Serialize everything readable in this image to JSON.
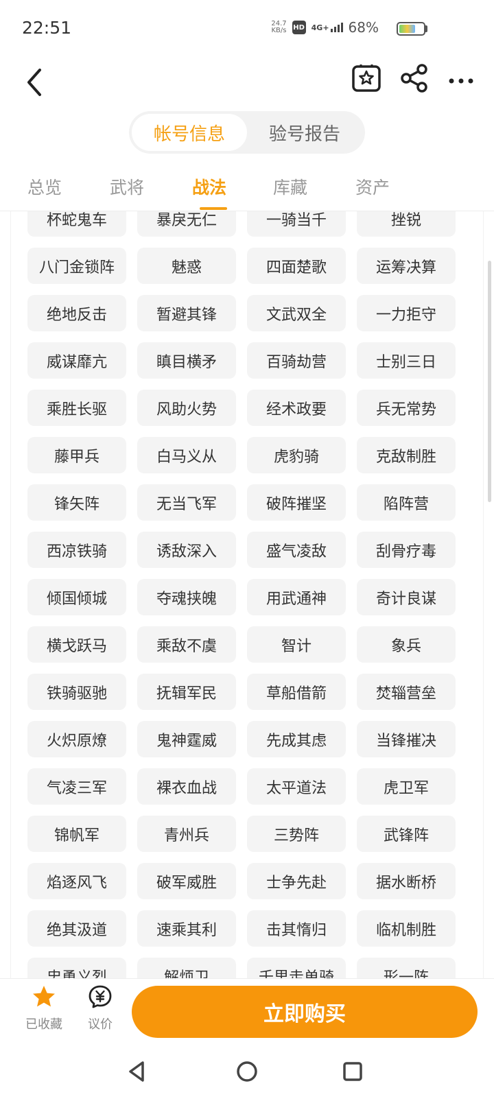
{
  "status": {
    "time": "22:51",
    "net_speed_value": "24.7",
    "net_speed_unit": "KB/s",
    "hd": "HD",
    "signal": "4G+",
    "battery": "68%"
  },
  "segment": {
    "active": "帐号信息",
    "inactive": "验号报告"
  },
  "tabs": [
    {
      "label": "总览"
    },
    {
      "label": "武将"
    },
    {
      "label": "战法"
    },
    {
      "label": "库藏"
    },
    {
      "label": "资产"
    }
  ],
  "skills": [
    "杯蛇鬼车",
    "暴戾无仁",
    "一骑当千",
    "挫锐",
    "八门金锁阵",
    "魅惑",
    "四面楚歌",
    "运筹决算",
    "绝地反击",
    "暂避其锋",
    "文武双全",
    "一力拒守",
    "威谋靡亢",
    "瞋目横矛",
    "百骑劫营",
    "士别三日",
    "乘胜长驱",
    "风助火势",
    "经术政要",
    "兵无常势",
    "藤甲兵",
    "白马义从",
    "虎豹骑",
    "克敌制胜",
    "锋矢阵",
    "无当飞军",
    "破阵摧坚",
    "陷阵营",
    "西凉铁骑",
    "诱敌深入",
    "盛气凌敌",
    "刮骨疗毒",
    "倾国倾城",
    "夺魂挟魄",
    "用武通神",
    "奇计良谋",
    "横戈跃马",
    "乘敌不虞",
    "智计",
    "象兵",
    "铁骑驱驰",
    "抚辑军民",
    "草船借箭",
    "焚辎营垒",
    "火炽原燎",
    "鬼神霆威",
    "先成其虑",
    "当锋摧决",
    "气凌三军",
    "裸衣血战",
    "太平道法",
    "虎卫军",
    "锦帆军",
    "青州兵",
    "三势阵",
    "武锋阵",
    "焰逐风飞",
    "破军威胜",
    "士争先赴",
    "据水断桥",
    "绝其汲道",
    "速乘其利",
    "击其惰归",
    "临机制胜",
    "忠勇义烈",
    "解烦卫",
    "千里走单骑",
    "形一阵"
  ],
  "bottom": {
    "favorite_label": "已收藏",
    "bargain_label": "议价",
    "buy_label": "立即购买"
  },
  "colors": {
    "accent": "#f5a014",
    "buy_button": "#f7960b",
    "chip_bg": "#f4f4f4"
  },
  "icons": [
    "back-arrow-icon",
    "favorite-star-icon",
    "share-icon",
    "more-icon",
    "star-icon",
    "yuan-chat-icon",
    "back-triangle-icon",
    "home-circle-icon",
    "recent-square-icon"
  ]
}
